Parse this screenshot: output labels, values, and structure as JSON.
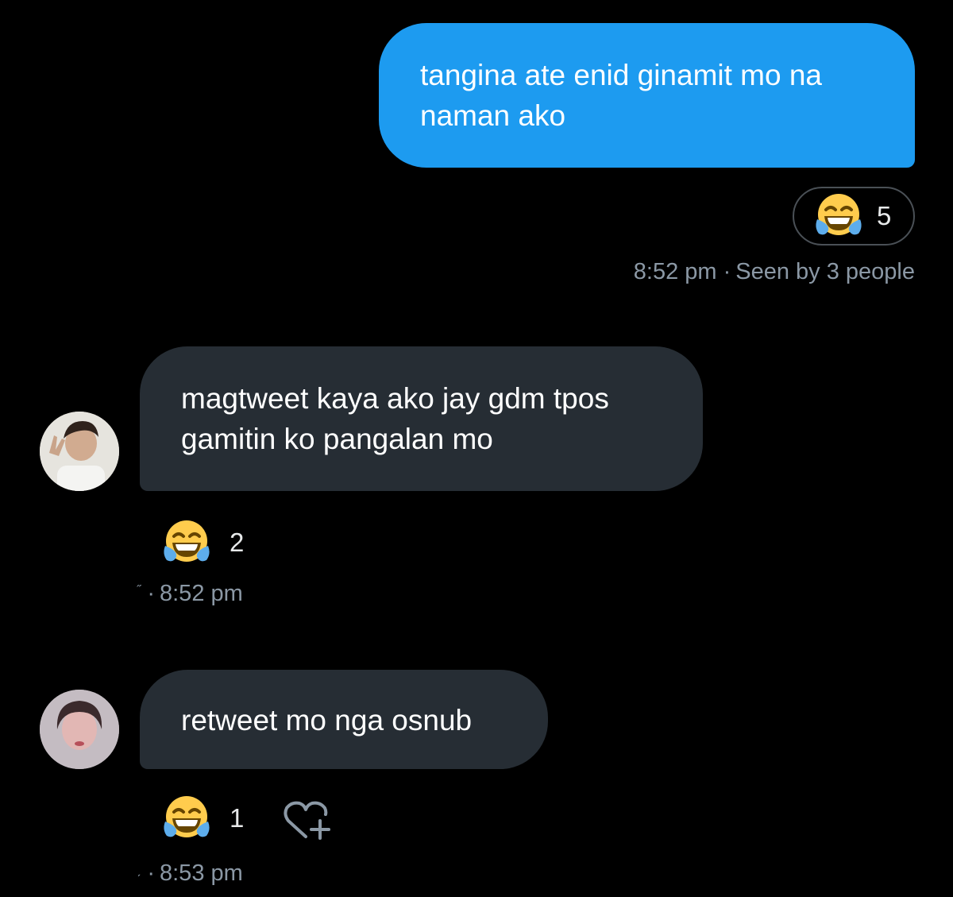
{
  "messages": [
    {
      "direction": "outgoing",
      "text_line1": "tangina ate enid ginamit mo na",
      "text_line2": "naman ako",
      "reaction": {
        "emoji": "face-with-tears-of-joy",
        "count": "5"
      },
      "time": "8:52 pm",
      "separator": "·",
      "seen": "Seen by 3 people"
    },
    {
      "direction": "incoming",
      "text_line1": "magtweet kaya ako jay gdm tpos",
      "text_line2": "gamitin ko pangalan mo",
      "reaction": {
        "emoji": "face-with-tears-of-joy",
        "count": "2"
      },
      "tick": "˝",
      "separator": "·",
      "time": "8:52 pm"
    },
    {
      "direction": "incoming",
      "text_line1": "retweet mo nga osnub",
      "reaction": {
        "emoji": "face-with-tears-of-joy",
        "count": "1"
      },
      "tick": "ˏ",
      "separator": "·",
      "time": "8:53 pm"
    }
  ],
  "colors": {
    "background": "#000000",
    "outgoing_bubble": "#1d9bf0",
    "incoming_bubble": "#262d34",
    "meta_text": "#8b98a5"
  },
  "icons": {
    "reaction_emoji": "laughing-tears-emoji-icon",
    "add_reaction": "heart-plus-icon"
  }
}
